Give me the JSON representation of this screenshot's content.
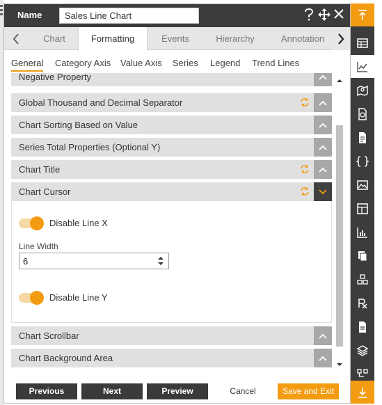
{
  "header": {
    "name_label": "Name",
    "name_value": "Sales Line Chart",
    "help_icon": "help-icon",
    "move_icon": "move-icon",
    "close_icon": "close-icon"
  },
  "tabs": [
    "Chart",
    "Formatting",
    "Events",
    "Hierarchy",
    "Annotation"
  ],
  "active_tab": "Formatting",
  "subtabs": [
    "General",
    "Category Axis",
    "Value Axis",
    "Series",
    "Legend",
    "Trend Lines"
  ],
  "active_subtab": "General",
  "sections": [
    {
      "label": "Negative Property",
      "refresh": false,
      "expanded": false
    },
    {
      "label": "Global Thousand and Decimal Separator",
      "refresh": true,
      "expanded": false
    },
    {
      "label": "Chart Sorting Based on Value",
      "refresh": false,
      "expanded": false
    },
    {
      "label": "Series Total Properties (Optional Y)",
      "refresh": false,
      "expanded": false
    },
    {
      "label": "Chart Title",
      "refresh": true,
      "expanded": false
    },
    {
      "label": "Chart Cursor",
      "refresh": true,
      "expanded": true
    },
    {
      "label": "Chart Scrollbar",
      "refresh": false,
      "expanded": false
    },
    {
      "label": "Chart Background Area",
      "refresh": false,
      "expanded": false
    }
  ],
  "chart_cursor": {
    "disable_line_x_label": "Disable Line X",
    "disable_line_x_on": true,
    "line_width_label": "Line Width",
    "line_width_value": "6",
    "disable_line_y_label": "Disable Line Y",
    "disable_line_y_on": true
  },
  "footer": {
    "previous": "Previous",
    "next": "Next",
    "preview": "Preview",
    "cancel": "Cancel",
    "save_exit": "Save and Exit"
  },
  "colors": {
    "accent": "#f39c12",
    "header_bg": "#3c3c3c",
    "row_bg": "#e0e0e0"
  },
  "rail_icons": [
    "collapse-up-icon",
    "table-icon",
    "line-chart-icon",
    "map-icon",
    "document-chart-icon",
    "document-icon",
    "braces-icon",
    "image-icon",
    "dashboard-icon",
    "bar-chart-icon",
    "copy-icon",
    "cubes-icon",
    "rx-icon",
    "report-icon",
    "layers-icon",
    "flow-icon",
    "download-icon"
  ]
}
